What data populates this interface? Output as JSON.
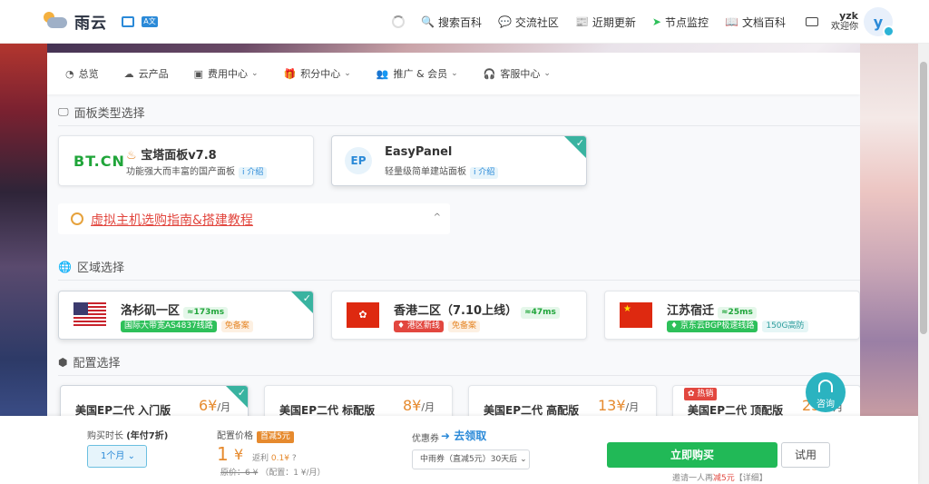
{
  "brand": {
    "name": "雨云",
    "mini_badge": "A文"
  },
  "topnav": {
    "items": [
      {
        "icon": "search-icon",
        "glyph": "🔍",
        "label": "搜索百科"
      },
      {
        "icon": "community-icon",
        "glyph": "💬",
        "label": "交流社区"
      },
      {
        "icon": "news-icon",
        "glyph": "📰",
        "label": "近期更新"
      },
      {
        "icon": "node-monitor-icon",
        "glyph": "➤",
        "label": "节点监控"
      },
      {
        "icon": "docs-icon",
        "glyph": "📖",
        "label": "文档百科"
      }
    ],
    "user": {
      "name": "yzk",
      "greeting": "欢迎你",
      "avatar_letter": "y"
    }
  },
  "subnav": {
    "items": [
      {
        "label": "总览",
        "glyph": "◔",
        "dropdown": false
      },
      {
        "label": "云产品",
        "glyph": "☁",
        "dropdown": false
      },
      {
        "label": "费用中心",
        "glyph": "▣",
        "dropdown": true
      },
      {
        "label": "积分中心",
        "glyph": "🎁",
        "dropdown": true
      },
      {
        "label": "推广 & 会员",
        "glyph": "👥",
        "dropdown": true
      },
      {
        "label": "客服中心",
        "glyph": "🎧",
        "dropdown": true
      }
    ]
  },
  "sections": {
    "panel_type": "面板类型选择",
    "region": "区域选择",
    "config": "配置选择"
  },
  "panels": [
    {
      "logo": "BT.CN",
      "title": "宝塔面板v7.8",
      "desc": "功能强大而丰富的国产面板",
      "tag": "i 介绍",
      "selected": false
    },
    {
      "logo": "EP",
      "title": "EasyPanel",
      "desc": "轻量级简单建站面板",
      "tag": "i 介绍",
      "selected": true
    }
  ],
  "guide": {
    "text": "虚拟主机选购指南&搭建教程",
    "chevron": "^"
  },
  "regions": [
    {
      "flag": "us",
      "name": "洛杉矶一区",
      "latency": "≈173ms",
      "tags": [
        {
          "text": "国际大带宽AS4837线路",
          "style": "green-solid"
        },
        {
          "text": "免备案",
          "style": "orange"
        }
      ],
      "selected": true
    },
    {
      "flag": "hk",
      "name": "香港二区（7.10上线）",
      "latency": "≈47ms",
      "tags": [
        {
          "text": "♦ 港区新线",
          "style": "red-solid"
        },
        {
          "text": "免备案",
          "style": "orange"
        }
      ],
      "selected": false
    },
    {
      "flag": "cn",
      "name": "江苏宿迁",
      "latency": "≈25ms",
      "tags": [
        {
          "text": "♦ 京东云BGP极速线路",
          "style": "green-solid"
        },
        {
          "text": "150G高防",
          "style": "teal"
        }
      ],
      "selected": false
    }
  ],
  "plans": [
    {
      "name": "美国EP二代 入门版",
      "price": "6¥",
      "unit": "/月",
      "selected": true,
      "hot": ""
    },
    {
      "name": "美国EP二代 标配版",
      "price": "8¥",
      "unit": "/月",
      "selected": false,
      "hot": ""
    },
    {
      "name": "美国EP二代 高配版",
      "price": "13¥",
      "unit": "/月",
      "selected": false,
      "hot": ""
    },
    {
      "name": "美国EP二代 顶配版",
      "price": "23¥",
      "unit": "/月",
      "selected": false,
      "hot": "✿ 热销"
    }
  ],
  "consult": {
    "label": "咨询"
  },
  "bottom": {
    "duration_label": "购买时长",
    "duration_hint": "(年付7折)",
    "duration_value": "1个月",
    "price_label": "配置价格",
    "price_badge": "首减5元",
    "price_value": "1",
    "price_currency": "¥",
    "rebate_label": "返利",
    "rebate_value": "0.1¥",
    "rebate_help": "?",
    "original": "原价：6 ¥",
    "config_note": "（配置：1 ¥/月）",
    "coupon_label": "优惠券",
    "coupon_get": "➜ 去领取",
    "coupon_value": "中雨券（直减5元）30天后",
    "buy": "立即购买",
    "try": "试用",
    "invite_prefix": "邀请一人再",
    "invite_bonus": "减5元",
    "invite_suffix": "【详细】"
  }
}
